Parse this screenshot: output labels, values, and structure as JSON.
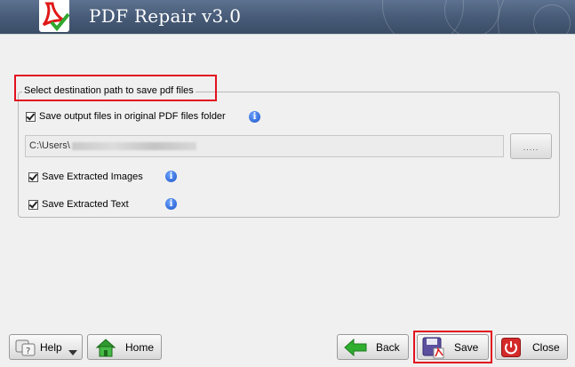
{
  "header": {
    "title": "PDF Repair v3.0"
  },
  "group": {
    "legend": "Select destination path to save pdf files"
  },
  "options": {
    "original_folder": {
      "label": "Save output files in original PDF files folder",
      "checked": true
    },
    "extract_images": {
      "label": "Save Extracted Images",
      "checked": true
    },
    "extract_text": {
      "label": "Save Extracted Text",
      "checked": true
    }
  },
  "path": {
    "value": "C:\\Users\\"
  },
  "browse": {
    "label": "....."
  },
  "footer": {
    "help_label": "Help",
    "home_label": "Home",
    "back_label": "Back",
    "save_label": "Save",
    "close_label": "Close"
  },
  "colors": {
    "highlight": "#e2101f",
    "header": "#4a5e7a",
    "info": "#1f5fd6"
  },
  "icons": {
    "logo": "pdf-check-logo-icon",
    "info": "info-icon",
    "help": "help-icon",
    "home": "home-icon",
    "back": "back-arrow-icon",
    "save": "save-disk-icon",
    "close": "power-icon"
  }
}
